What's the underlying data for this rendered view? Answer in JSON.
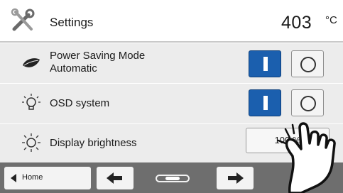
{
  "header": {
    "title": "Settings",
    "temperature": "403",
    "unit": "°C",
    "icon": "tools-icon"
  },
  "rows": [
    {
      "label_line1": "Power Saving Mode",
      "label_line2": "Automatic",
      "icon": "leaf-icon",
      "on_label": "I",
      "off_label": "O",
      "state": "on"
    },
    {
      "label": "OSD system",
      "icon": "lightbulb-icon",
      "on_label": "I",
      "off_label": "O",
      "state": "on"
    },
    {
      "label": "Display brightness",
      "icon": "sun-icon",
      "value": "100 %"
    }
  ],
  "bottom": {
    "home_label": "Home",
    "back_icon": "arrow-left-icon",
    "forward_icon": "arrow-right-icon"
  }
}
